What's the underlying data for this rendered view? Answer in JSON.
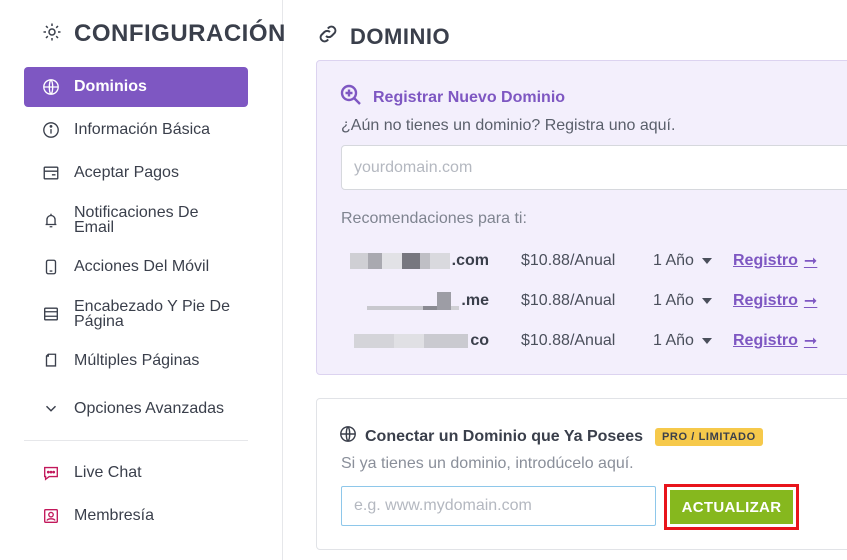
{
  "sidebar": {
    "title": "CONFIGURACIÓN",
    "title_icon": "gear-icon",
    "items": [
      {
        "label": "Dominios",
        "icon": "globe-icon",
        "active": true
      },
      {
        "label": "Información Básica",
        "icon": "info-icon"
      },
      {
        "label": "Aceptar Pagos",
        "icon": "payment-icon"
      },
      {
        "label": "Notificaciones De Email",
        "icon": "bell-icon"
      },
      {
        "label": "Acciones Del Móvil",
        "icon": "mobile-icon"
      },
      {
        "label": "Encabezado Y Pie De Página",
        "icon": "layout-icon"
      },
      {
        "label": "Múltiples Páginas",
        "icon": "pages-icon"
      },
      {
        "label": "Opciones Avanzadas",
        "icon": "chevron-down-icon"
      }
    ],
    "extras": [
      {
        "label": "Live Chat",
        "icon": "chat-icon"
      },
      {
        "label": "Membresía",
        "icon": "member-icon"
      }
    ]
  },
  "main": {
    "title": "DOMINIO",
    "title_icon": "link-icon",
    "register": {
      "title": "Registrar Nuevo Dominio",
      "subtitle": "¿Aún no tienes un dominio? Registra uno aquí.",
      "placeholder": "yourdomain.com",
      "recommend_label": "Recomendaciones para ti:",
      "rows": [
        {
          "suffix": ".com",
          "price": "$10.88/Anual",
          "years": "1 Año",
          "link": "Registro"
        },
        {
          "suffix": ".me",
          "price": "$10.88/Anual",
          "years": "1 Año",
          "link": "Registro"
        },
        {
          "suffix": "co",
          "price": "$10.88/Anual",
          "years": "1 Año",
          "link": "Registro"
        }
      ]
    },
    "connect": {
      "title": "Conectar un Dominio que Ya Posees",
      "badge": "PRO / LIMITADO",
      "subtitle": "Si ya tienes un dominio, introdúcelo aquí.",
      "placeholder": "e.g. www.mydomain.com",
      "button": "ACTUALIZAR"
    }
  },
  "colors": {
    "accent": "#7e57c2",
    "button": "#86b81e",
    "highlight": "#e8141b",
    "badge": "#f6c94b"
  }
}
